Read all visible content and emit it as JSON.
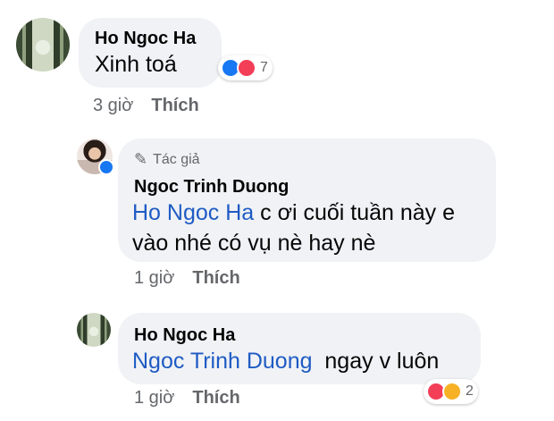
{
  "comments": [
    {
      "author": "Ho Ngoc Ha",
      "text": "Xinh toá",
      "time": "3 giờ",
      "like_label": "Thích",
      "reactions": {
        "types": [
          "like",
          "love"
        ],
        "count": "7"
      }
    },
    {
      "author_badge": "Tác giả",
      "author": "Ngoc Trinh Duong",
      "mention": "Ho Ngoc Ha",
      "text_line1": " c ơi cuối tuần này e",
      "text_line2": "vào nhé có vụ nè hay nè",
      "time": "1 giờ",
      "like_label": "Thích"
    },
    {
      "author": "Ho Ngoc Ha",
      "mention": "Ngoc Trinh Duong",
      "text": "  ngay v luôn",
      "time": "1 giờ",
      "like_label": "Thích",
      "reactions": {
        "types": [
          "love",
          "care"
        ],
        "count": "2"
      }
    }
  ],
  "colors": {
    "bubble": "#f0f2f5",
    "link": "#1f5bc4",
    "meta": "#65676b"
  }
}
